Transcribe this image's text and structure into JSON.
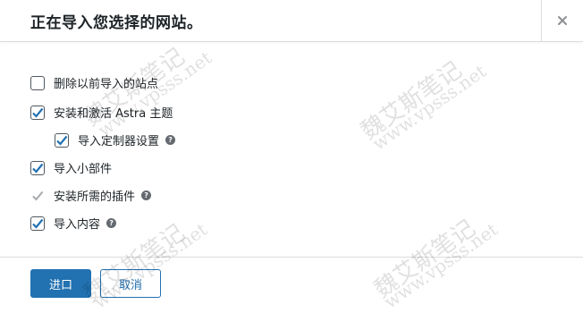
{
  "dialog": {
    "title": "正在导入您选择的网站。",
    "close_icon": "close-icon"
  },
  "options": [
    {
      "label": "删除以前导入的站点",
      "checked": false
    },
    {
      "label": "安装和激活 Astra 主题",
      "checked": true
    },
    {
      "label": "导入定制器设置",
      "checked": true,
      "help": "?"
    },
    {
      "label": "导入小部件",
      "checked": true
    },
    {
      "label": "安装所需的插件",
      "checked": true,
      "disabled": true,
      "help": "?"
    },
    {
      "label": "导入内容",
      "checked": true,
      "help": "?"
    }
  ],
  "footer": {
    "primary_label": "进口",
    "secondary_label": "取消"
  },
  "watermark": {
    "name": "魏艾斯笔记",
    "url": "www.vpsss.net"
  },
  "colors": {
    "accent": "#2271b1",
    "border": "#dcdcde"
  }
}
